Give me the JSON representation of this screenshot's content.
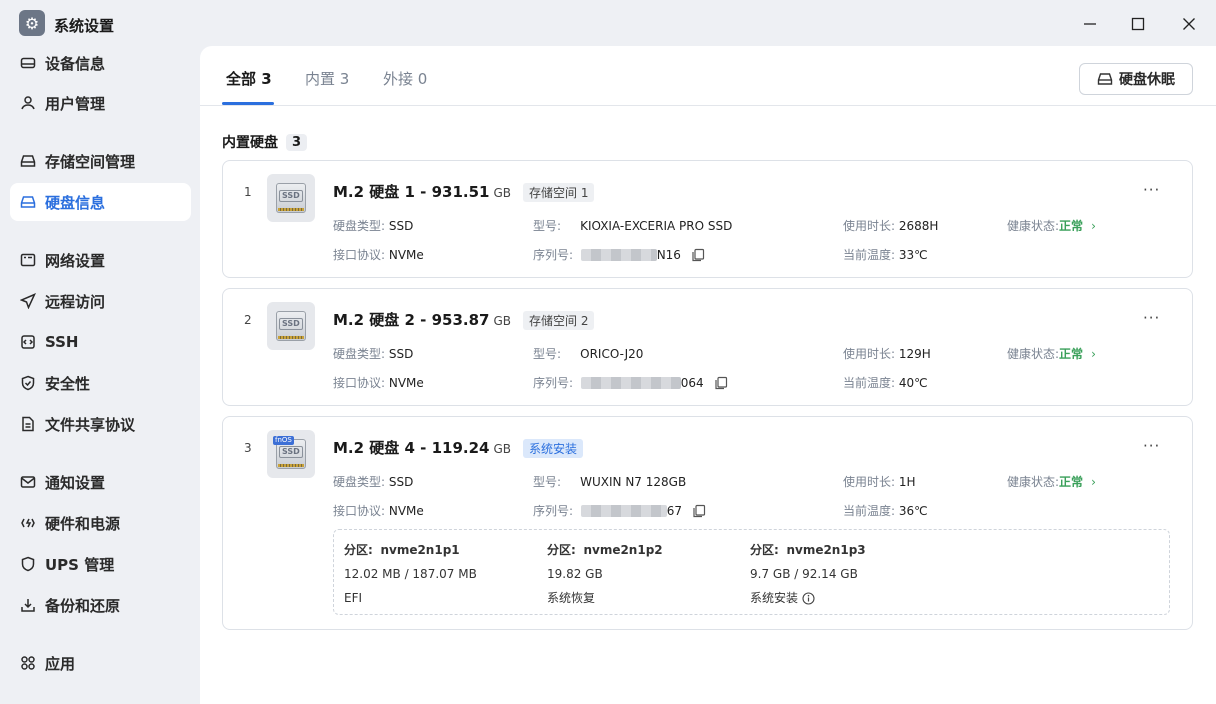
{
  "window": {
    "title": "系统设置"
  },
  "sidebar": {
    "items": [
      {
        "label": "设备信息",
        "icon": "device-icon"
      },
      {
        "label": "用户管理",
        "icon": "user-icon"
      },
      {
        "label": "存储空间管理",
        "icon": "storage-icon"
      },
      {
        "label": "硬盘信息",
        "icon": "disk-icon",
        "active": true
      },
      {
        "label": "网络设置",
        "icon": "network-icon"
      },
      {
        "label": "远程访问",
        "icon": "send-icon"
      },
      {
        "label": "SSH",
        "icon": "terminal-icon"
      },
      {
        "label": "安全性",
        "icon": "shield-icon"
      },
      {
        "label": "文件共享协议",
        "icon": "document-icon"
      },
      {
        "label": "通知设置",
        "icon": "mail-icon"
      },
      {
        "label": "硬件和电源",
        "icon": "power-icon"
      },
      {
        "label": "UPS 管理",
        "icon": "shield-outline-icon"
      },
      {
        "label": "备份和还原",
        "icon": "backup-icon"
      },
      {
        "label": "应用",
        "icon": "apps-icon"
      }
    ]
  },
  "tabs": [
    {
      "label": "全部 3",
      "active": true
    },
    {
      "label": "内置 3"
    },
    {
      "label": "外接 0"
    }
  ],
  "sleep_button": "硬盘休眠",
  "section": {
    "title": "内置硬盘",
    "count": "3"
  },
  "labels": {
    "type": "硬盘类型:",
    "protocol": "接口协议:",
    "model": "型号:",
    "serial": "序列号:",
    "hours": "使用时长:",
    "temp": "当前温度:",
    "health": "健康状态:",
    "partition": "分区:"
  },
  "disks": [
    {
      "index": "1",
      "name": "M.2 硬盘 1 - 931.51",
      "unit": "GB",
      "tag": "存储空间 1",
      "type": "SSD",
      "protocol": "NVMe",
      "model": "KIOXIA-EXCERIA PRO SSD",
      "serial_tail": "N16",
      "hours": "2688H",
      "temp": "33℃",
      "health": "正常"
    },
    {
      "index": "2",
      "name": "M.2 硬盘 2 - 953.87",
      "unit": "GB",
      "tag": "存储空间 2",
      "type": "SSD",
      "protocol": "NVMe",
      "model": "ORICO-J20",
      "serial_tail": "064",
      "hours": "129H",
      "temp": "40℃",
      "health": "正常"
    },
    {
      "index": "3",
      "name": "M.2 硬盘 4 - 119.24",
      "unit": "GB",
      "tag": "系统安装",
      "type": "SSD",
      "protocol": "NVMe",
      "model": "WUXIN N7 128GB",
      "serial_tail": "67",
      "hours": "1H",
      "temp": "36℃",
      "health": "正常",
      "fnos_label": "fnOS",
      "partitions": [
        {
          "name": "nvme2n1p1",
          "size": "12.02 MB / 187.07 MB",
          "desc": "EFI"
        },
        {
          "name": "nvme2n1p2",
          "size": "19.82 GB",
          "desc": "系统恢复"
        },
        {
          "name": "nvme2n1p3",
          "size": "9.7 GB / 92.14 GB",
          "desc": "系统安装"
        }
      ]
    }
  ],
  "ssd_label": "SSD",
  "more_label": "···",
  "colors": {
    "accent": "#2b6fde",
    "healthy": "#3aa05a"
  }
}
